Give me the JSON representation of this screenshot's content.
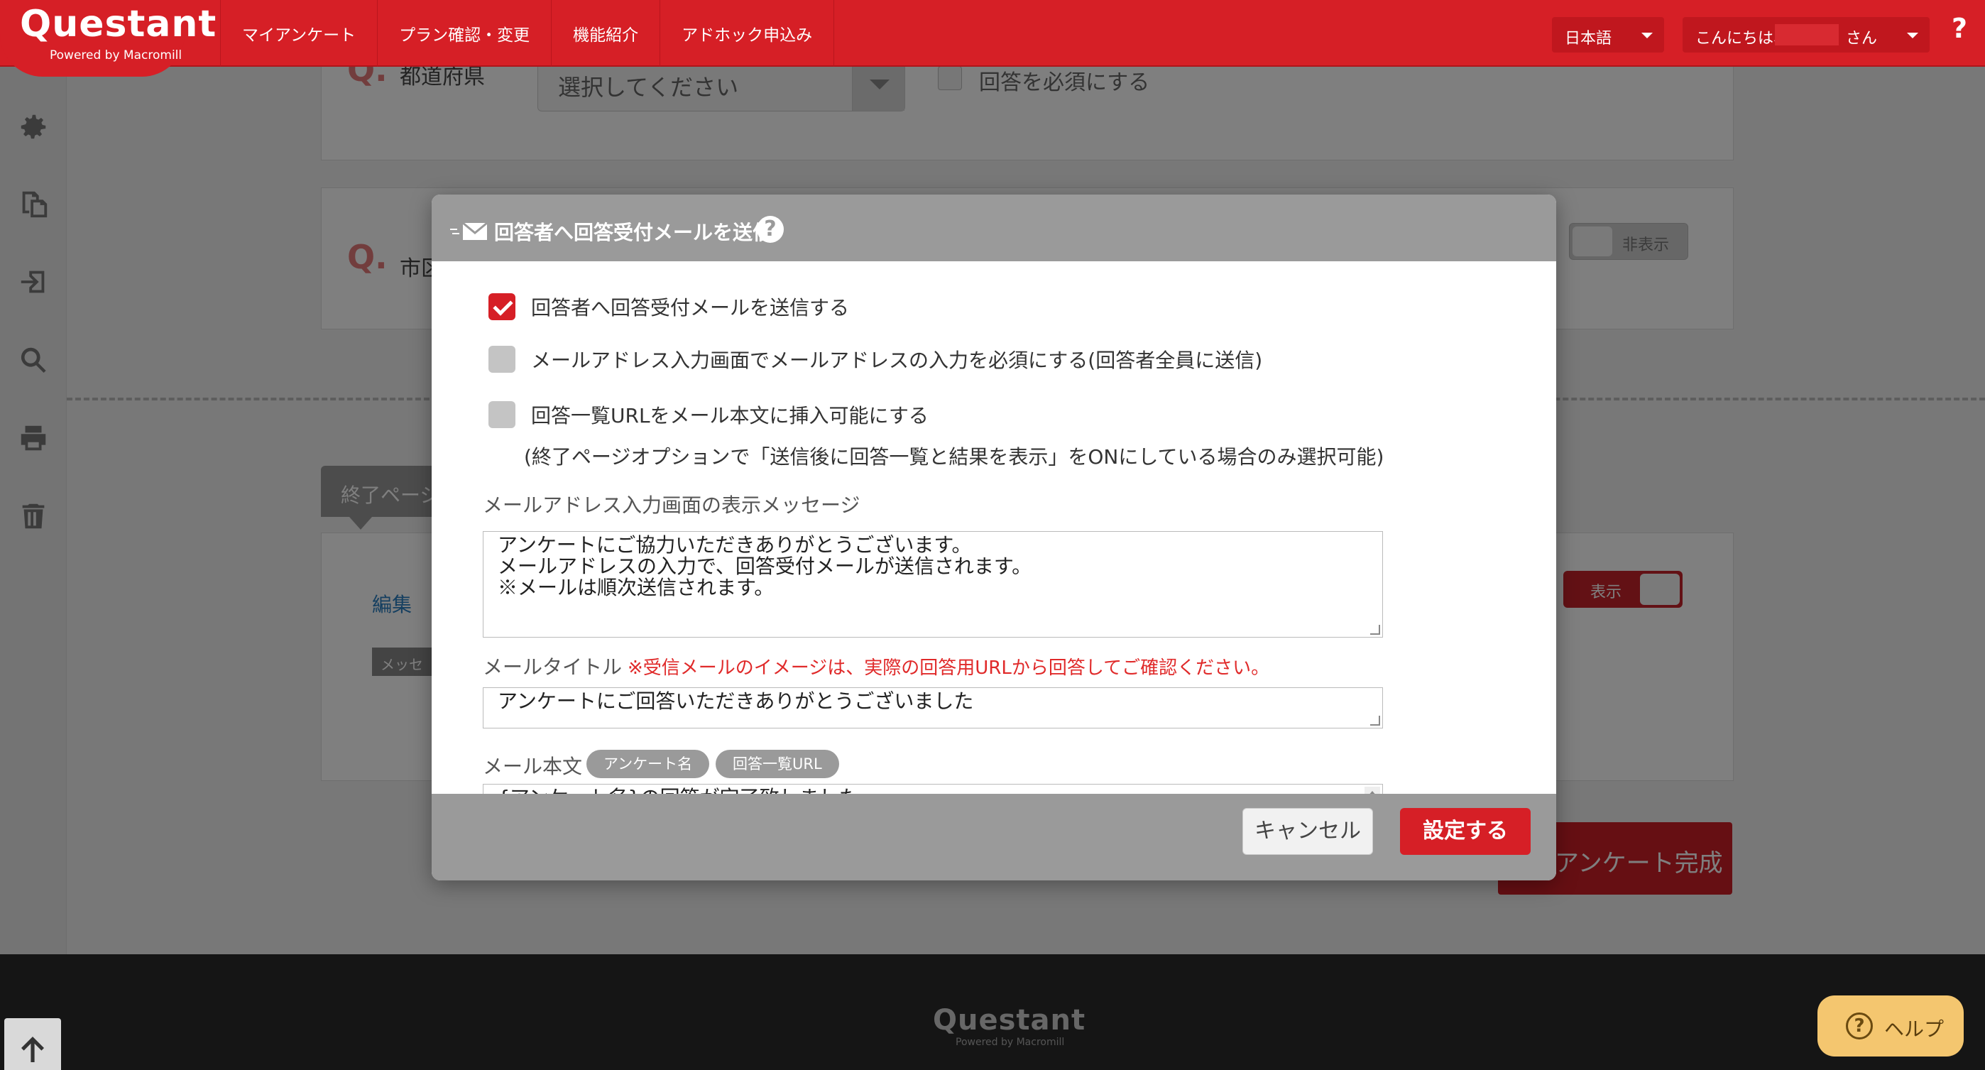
{
  "header": {
    "logo": "Questant",
    "logo_sub": "Powered by Macromill",
    "nav": [
      "マイアンケート",
      "プラン確認・変更",
      "機能紹介",
      "アドホック申込み"
    ],
    "language": "日本語",
    "greeting": "こんにちは、",
    "greeting_suffix": "さん",
    "help": "?"
  },
  "background": {
    "q1_label": "Q.",
    "q1_text": "都道府県",
    "q1_select_placeholder": "選択してください",
    "q1_required_label": "回答を必須にする",
    "q2_label": "Q.",
    "q2_text": "市区",
    "toggle_hidden_label": "非表示",
    "end_page_tag": "終了ページ",
    "edit_link": "編集",
    "message_chip": "メッセージ",
    "toggle_show_label": "表示",
    "complete_button": "アンケート完成",
    "footer_logo": "Questant",
    "footer_sub": "Powered by Macromill"
  },
  "modal": {
    "title": "回答者へ回答受付メールを送信",
    "help": "?",
    "checkboxes": [
      {
        "label": "回答者へ回答受付メールを送信する",
        "checked": true
      },
      {
        "label": "メールアドレス入力画面でメールアドレスの入力を必須にする(回答者全員に送信)",
        "checked": false
      },
      {
        "label": "回答一覧URLをメール本文に挿入可能にする",
        "checked": false
      }
    ],
    "checkbox3_note": "(終了ページオプションで「送信後に回答一覧と結果を表示」をONにしている場合のみ選択可能)",
    "display_message_label": "メールアドレス入力画面の表示メッセージ",
    "display_message_value": "アンケートにご協力いただきありがとうございます。\nメールアドレスの入力で、回答受付メールが送信されます。\n※メールは順次送信されます。",
    "mail_title_label": "メールタイトル",
    "mail_title_warning": "※受信メールのイメージは、実際の回答用URLから回答してご確認ください。",
    "mail_title_value": "アンケートにご回答いただきありがとうございました",
    "mail_body_label": "メール本文",
    "insert_survey_name": "アンケート名",
    "insert_answer_url": "回答一覧URL",
    "mail_body_value": "{アンケート名}の回答が完了致しました。\nご回答くださりありがとうございました。",
    "cancel_button": "キャンセル",
    "submit_button": "設定する"
  },
  "floating": {
    "help_button": "ヘルプ",
    "help_icon": "?"
  },
  "colors": {
    "brand_red": "#d61f26",
    "modal_header": "#9a9a9a",
    "warning": "#e02a2a",
    "help_yellow": "#f4c66f"
  },
  "icons": [
    "gear-icon",
    "copy-icon",
    "share-icon",
    "search-icon",
    "print-icon",
    "trash-icon",
    "mail-icon",
    "arrow-up-icon",
    "help-icon"
  ]
}
